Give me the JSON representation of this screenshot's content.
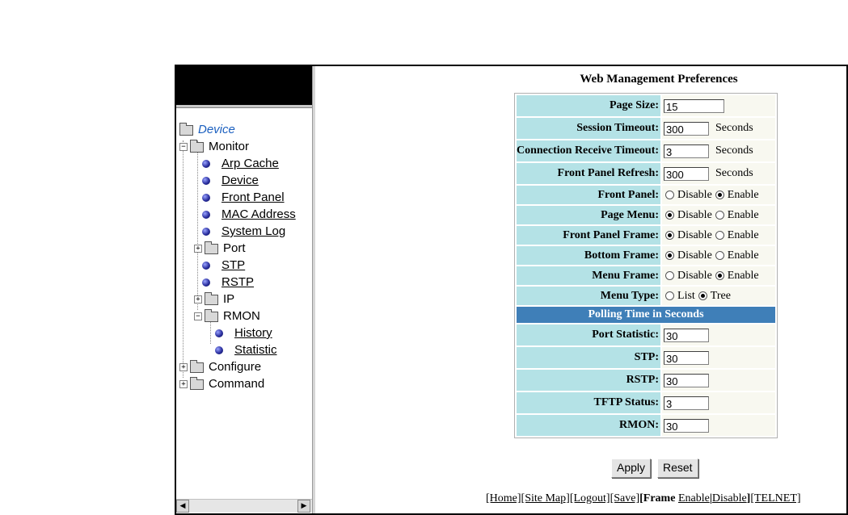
{
  "nav": {
    "tree": [
      {
        "label": "Device",
        "kind": "root"
      },
      {
        "label": "Monitor",
        "kind": "folder-open"
      },
      {
        "label": "Arp Cache",
        "kind": "link"
      },
      {
        "label": "Device",
        "kind": "link"
      },
      {
        "label": "Front Panel",
        "kind": "link"
      },
      {
        "label": "MAC Address",
        "kind": "link"
      },
      {
        "label": "System Log",
        "kind": "link"
      },
      {
        "label": "Port",
        "kind": "folder-closed"
      },
      {
        "label": "STP",
        "kind": "link"
      },
      {
        "label": "RSTP",
        "kind": "link"
      },
      {
        "label": "IP",
        "kind": "folder-closed"
      },
      {
        "label": "RMON",
        "kind": "folder-open"
      },
      {
        "label": "History",
        "kind": "link"
      },
      {
        "label": "Statistic",
        "kind": "link"
      },
      {
        "label": "Configure",
        "kind": "folder-closed"
      },
      {
        "label": "Command",
        "kind": "folder-closed"
      }
    ],
    "scroll_left_icon": "arrow-left-icon",
    "scroll_right_icon": "arrow-right-icon"
  },
  "main": {
    "title": "Web Management Preferences",
    "rows": {
      "page_size": {
        "label": "Page Size:",
        "value": "15"
      },
      "session_timeout": {
        "label": "Session Timeout:",
        "value": "300",
        "unit": "Seconds"
      },
      "conn_timeout": {
        "label": "Connection Receive Timeout:",
        "value": "3",
        "unit": "Seconds"
      },
      "panel_refresh": {
        "label": "Front Panel Refresh:",
        "value": "300",
        "unit": "Seconds"
      },
      "front_panel": {
        "label": "Front Panel:",
        "opt1": "Disable",
        "opt2": "Enable",
        "selected": "Enable"
      },
      "page_menu": {
        "label": "Page Menu:",
        "opt1": "Disable",
        "opt2": "Enable",
        "selected": "Disable"
      },
      "front_panel_frame": {
        "label": "Front Panel Frame:",
        "opt1": "Disable",
        "opt2": "Enable",
        "selected": "Disable"
      },
      "bottom_frame": {
        "label": "Bottom Frame:",
        "opt1": "Disable",
        "opt2": "Enable",
        "selected": "Disable"
      },
      "menu_frame": {
        "label": "Menu Frame:",
        "opt1": "Disable",
        "opt2": "Enable",
        "selected": "Enable"
      },
      "menu_type": {
        "label": "Menu Type:",
        "opt1": "List",
        "opt2": "Tree",
        "selected": "Tree"
      }
    },
    "polling_heading": "Polling Time in Seconds",
    "polling": {
      "port_statistic": {
        "label": "Port Statistic:",
        "value": "30"
      },
      "stp": {
        "label": "STP:",
        "value": "30"
      },
      "rstp": {
        "label": "RSTP:",
        "value": "30"
      },
      "tftp_status": {
        "label": "TFTP Status:",
        "value": "3"
      },
      "rmon": {
        "label": "RMON:",
        "value": "30"
      }
    },
    "buttons": {
      "apply": "Apply",
      "reset": "Reset"
    },
    "footer": {
      "home": "[Home]",
      "site_map": "[Site Map]",
      "logout": "[Logout]",
      "save": "[Save]",
      "frame_prefix": "[Frame",
      "enable": "Enable",
      "sep": "|",
      "disable": "Disable",
      "frame_suffix": "]",
      "telnet": "[TELNET]"
    }
  }
}
